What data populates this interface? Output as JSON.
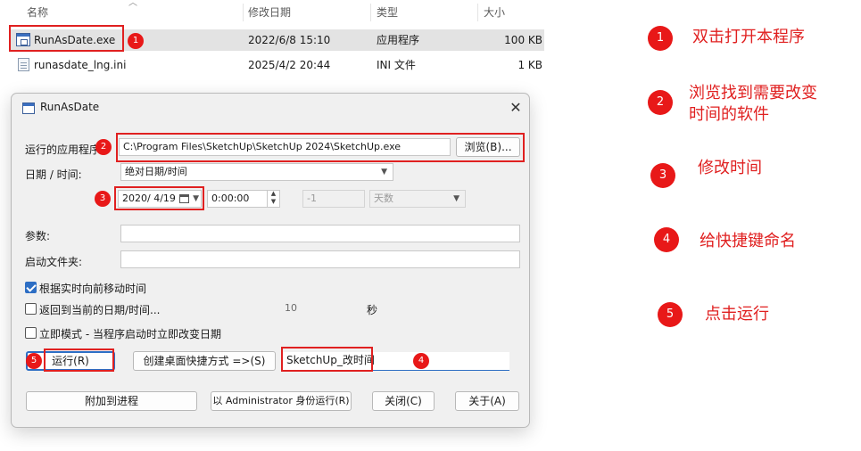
{
  "explorer": {
    "columns": [
      "名称",
      "修改日期",
      "类型",
      "大小"
    ],
    "files": [
      {
        "name": "RunAsDate.exe",
        "modified": "2022/6/8 15:10",
        "type": "应用程序",
        "size": "100 KB",
        "icon": "exe-icon"
      },
      {
        "name": "runasdate_lng.ini",
        "modified": "2025/4/2 20:44",
        "type": "INI 文件",
        "size": "1 KB",
        "icon": "ini-file-icon"
      }
    ]
  },
  "dialog": {
    "title": "RunAsDate",
    "close_symbol": "✕",
    "app_label": "运行的应用程序",
    "app_path": "C:\\Program Files\\SketchUp\\SketchUp 2024\\SketchUp.exe",
    "browse_label": "浏览(B)...",
    "datetime_label": "日期 / 时间:",
    "mode_value": "绝对日期/时间",
    "date_value": "2020/  4/19",
    "time_value": "0:00:00",
    "offset_value": "-1",
    "unit_value": "天数",
    "params_label": "参数:",
    "params_value": "",
    "startdir_label": "启动文件夹:",
    "startdir_value": "",
    "check_forward": {
      "label": "根据实时向前移动时间",
      "checked": true
    },
    "check_return": {
      "label": "返回到当前的日期/时间...",
      "checked": false
    },
    "return_seconds": "10",
    "seconds_unit": "秒",
    "check_immediate": {
      "label": "立即模式 - 当程序启动时立即改变日期",
      "checked": false
    },
    "run_label": "运行(R)",
    "shortcut_label": "创建桌面快捷方式 =>(S)",
    "shortcut_name": "SketchUp_改时间",
    "attach_label": "附加到进程",
    "admin_label": "以 Administrator 身份运行(R)",
    "closebtn_label": "关闭(C)",
    "about_label": "关于(A)"
  },
  "annotations": {
    "accent": "#e02020",
    "badges": [
      "1",
      "2",
      "3",
      "4",
      "5"
    ],
    "steps": [
      {
        "num": "1",
        "text": "双击打开本程序"
      },
      {
        "num": "2",
        "text": "浏览找到需要改变",
        "text2": "时间的软件"
      },
      {
        "num": "3",
        "text": "修改时间"
      },
      {
        "num": "4",
        "text": "给快捷键命名"
      },
      {
        "num": "5",
        "text": "点击运行"
      }
    ]
  }
}
